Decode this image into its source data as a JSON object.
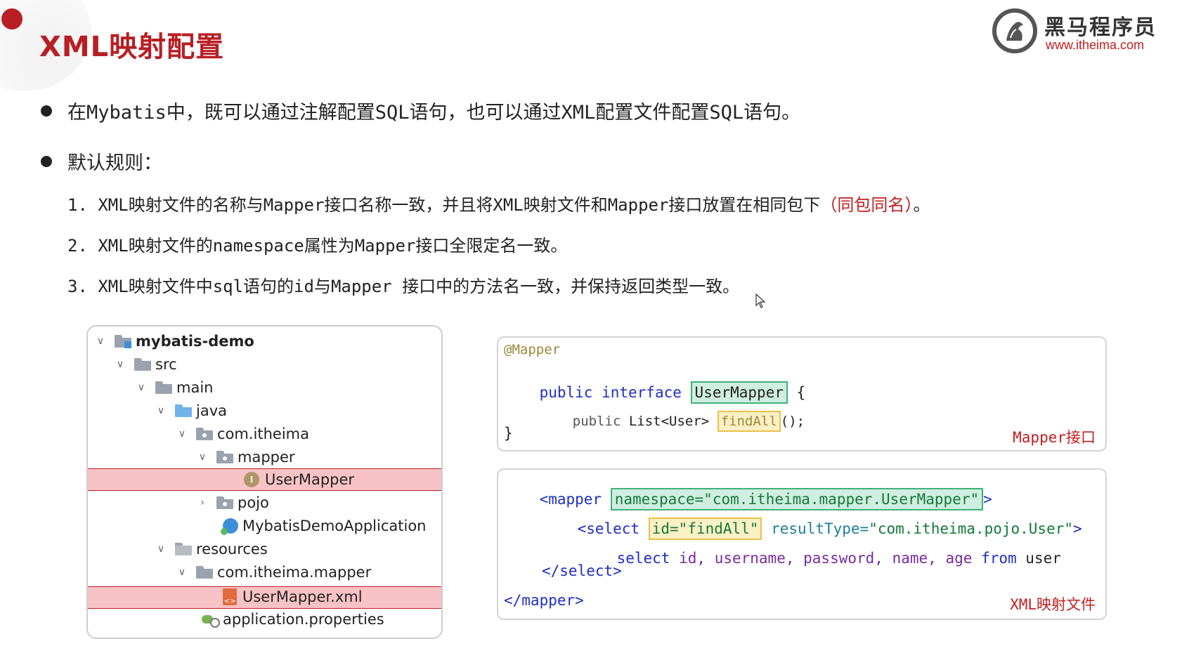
{
  "header": {
    "title": "XML映射配置",
    "logo_cn": "黑马程序员",
    "logo_url": "www.itheima.com"
  },
  "bullets": [
    "在Mybatis中，既可以通过注解配置SQL语句，也可以通过XML配置文件配置SQL语句。",
    "默认规则："
  ],
  "rules": {
    "r1_prefix": "1.  XML映射文件的名称与Mapper接口名称一致，并且将XML映射文件和Mapper接口放置在相同包下",
    "r1_highlight": "（同包同名）",
    "r1_suffix": "。",
    "r2": "2.  XML映射文件的namespace属性为Mapper接口全限定名一致。",
    "r3": "3.  XML映射文件中sql语句的id与Mapper 接口中的方法名一致，并保持返回类型一致。"
  },
  "tree": {
    "project": "mybatis-demo",
    "src": "src",
    "main": "main",
    "java": "java",
    "pkg": "com.itheima",
    "mapper": "mapper",
    "user_mapper": "UserMapper",
    "pojo": "pojo",
    "app": "MybatisDemoApplication",
    "resources": "resources",
    "res_pkg": "com.itheima.mapper",
    "user_mapper_xml": "UserMapper.xml",
    "props": "application.properties",
    "iface_letter": "I",
    "xml_letter": "<>"
  },
  "mapper_code": {
    "annotation": "@Mapper",
    "public": "public",
    "interface": "interface",
    "iface_name": "UserMapper",
    "open_brace": "{",
    "method_public": "public",
    "method_type": "List<User>",
    "method_name": "findAll",
    "method_tail": "();",
    "close_brace": "}",
    "label": "Mapper接口"
  },
  "xml_code": {
    "open_tag": "<mapper",
    "namespace": "namespace=\"com.itheima.mapper.UserMapper\"",
    "open_tag_end": ">",
    "select_open": "<select",
    "select_id": "id=\"findAll\"",
    "result_type_attr": "resultType=",
    "result_type_val": "\"com.itheima.pojo.User\"",
    "select_open_end": ">",
    "sql_select": "select",
    "sql_id": "id,",
    "sql_username": "username,",
    "sql_password": "password,",
    "sql_name": "name,",
    "sql_age": "age",
    "sql_from": "from",
    "sql_table": "user",
    "select_close": "</select>",
    "close_tag": "</mapper>",
    "label": "XML映射文件"
  }
}
